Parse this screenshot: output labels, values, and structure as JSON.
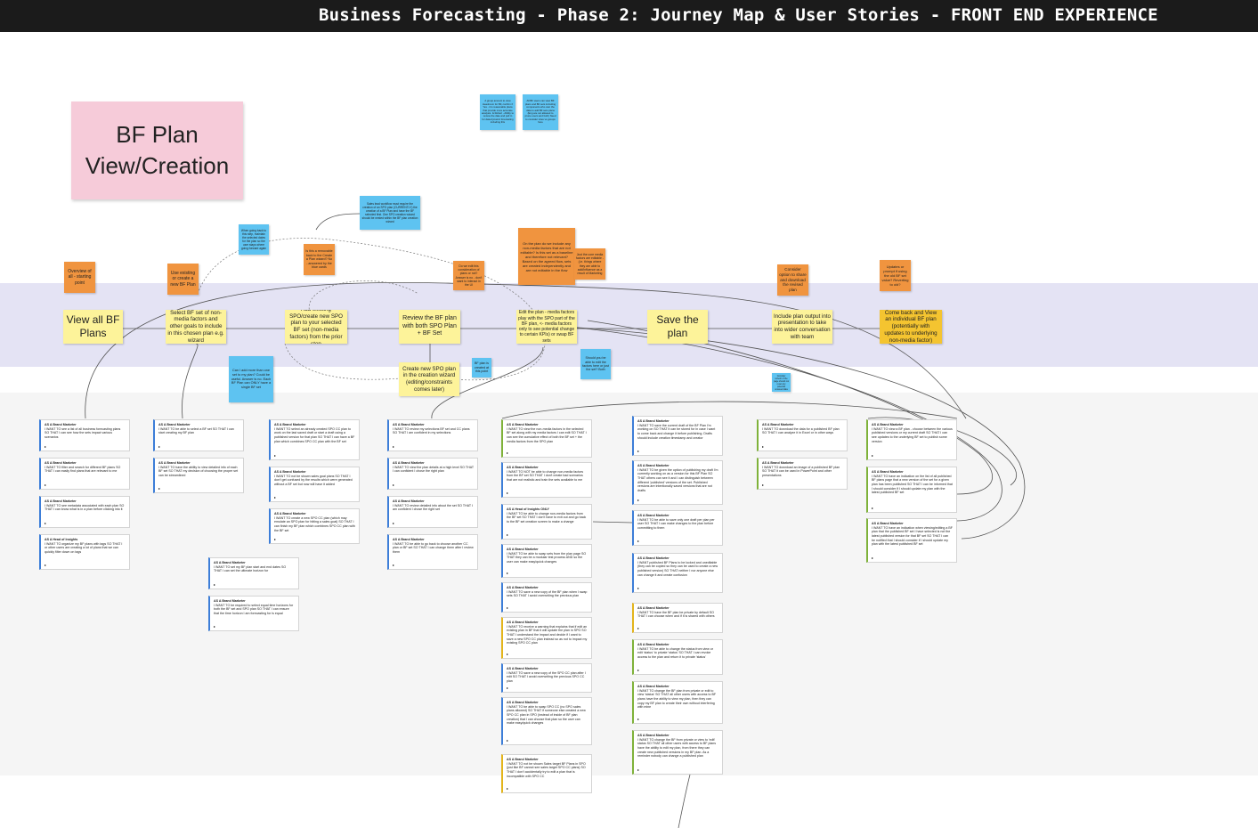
{
  "header": {
    "title": "Business Forecasting - Phase 2: Journey Map & User Stories - FRONT END EXPERIENCE"
  },
  "frame_title": "BF Plan View/Creation",
  "journey_steps": [
    "View all BF Plans",
    "Select BF set of non-media factors and other goals to include in this chosen plan e.g. wizard",
    "Add existing SPO/create new SPO plan to your selected BF set (non-media factors) from the prior step",
    "Review the BF plan with both SPO Plan + BF Set",
    "Edit the plan - media factors play with the SPO part of the BF plan, <- media factors only to see potential change to certain KPIs) or swap BF sets",
    "Save the plan",
    "Include plan output into presentation to take into wider conversation with team",
    "Come back and View an individual BF plan (potentially with updates to underlying non-media factor)"
  ],
  "branch_step": "Create new SPO plan in the creation wizard (editing/constraints comes later)",
  "orange_notes": [
    "Overview of all - starting point",
    "Use existing or create a new BF Plan",
    "Is this a removable back to the Create a Plan wizard? No - answered by the blue cards",
    "Do we edit this consideration of plans or not? Answer is no - don't want to interact in the UI",
    "On the plan do we include any non-media factors that are not editable? Is this set as a baseline and therefore not relevant? Based on the agreed flow, sets are created independently and are not editable in the flow",
    "Just the core media factors are editable - (i.e. things where they are able to add/influence as a result of Marketing",
    "Consider option to share and download the revised plan",
    "Updates or prompt if using the old BF set value? Reverting to old?"
  ],
  "blue_notes": [
    "A group amount to view Headroom for BF, confirm if Yes - it is reasonable plans that provide more accurate analysis. Is Robert - Ability to review the date and pull in for data dynamic forecasting including this",
    "All BF users can view BF plans and BF sets including components who own the data to add BF sets plans (Eng are not allowed to prune users and both) Need to consider roles vs groups here",
    "When going back to this step, maintain the selected dates for the plan so the user stays where going forward again",
    "Sales lead workflow must require the creation of an SPO plan (CURRENTLY) the creation of a BF Plan and have the BF selected first. One SPO creation wizard should be nested within the BF plan creation wizard",
    "Can I add more than one set to my plan? Could be useful. Answer is no. Each BF Plan can ONLY have a single BF set",
    "BF plan is created at this point",
    "Should you be able to edit the factors here or just the set? Both",
    "Consider refresh of the page should not reset any potential unsaved data"
  ],
  "story_columns": [
    {
      "cards": [
        {
          "who": "AS A Brand Marketer",
          "text": "I WANT TO see a list of all business forecasting plans SO THAT I can see how the sets impact various scenarios"
        },
        {
          "who": "AS A Brand Marketer",
          "text": "I WANT TO filter and search for different BF plans SO THAT I can easily find plans that are relevant to me"
        },
        {
          "who": "AS A Brand Marketer",
          "text": "I WANT TO see metadata associated with each plan SO THAT I can know what is in a plan before clicking into it"
        },
        {
          "who": "AS A Head of Insights",
          "text": "I WANT TO organize my BF plans with tags SO THAT I or other users are creating a lot of plans that we can quickly filter down on tags"
        }
      ]
    },
    {
      "cards": [
        {
          "who": "AS A Brand Marketer",
          "text": "I WANT TO be able to select a BF set SO THAT I can start creating my BF plan"
        },
        {
          "who": "AS A Brand Marketer",
          "text": "I WANT TO have the ability to view detailed info of each BF set SO THAT my decision of choosing the proper set can be streamlined"
        }
      ]
    },
    {
      "cards": [
        {
          "who": "AS A Brand Marketer",
          "text": "I WANT TO set my BF plan start and end dates SO THAT I can set the ultimate horizon for"
        },
        {
          "who": "AS A Brand Marketer",
          "text": "I WANT TO be required to select equal time horizons for both the BF set and SPO plan SO THAT I can ensure that the time horizon I am forecasting for is equal"
        }
      ]
    },
    {
      "cards": [
        {
          "who": "AS A Brand Marketer",
          "text": "I WANT TO select an already created SPO CC plan to work on the last saved draft or start a draft using a published version for that plan SO THAT I can have a BF plan which combines SPO CC plan with the BF set"
        },
        {
          "who": "AS A Brand Marketer",
          "text": "I WANT TO not be shown sales goal plans SO THAT I don't get confused by the results which were generated without a BF set but now will have it added"
        },
        {
          "who": "AS A Brand Marketer",
          "text": "I WANT TO create a new SPO CC plan (which may emulate an SPO plan for hitting a sales goal) SO THAT I can finish my BF plan which combines SPO CC plan with the BF set"
        }
      ]
    },
    {
      "cards": [
        {
          "who": "AS A Brand Marketer",
          "text": "I WANT TO review my selections BF set and CC plans SO THAT I am confident in my selections"
        },
        {
          "who": "AS A Brand Marketer",
          "text": "I WANT TO view the plan details at a high level SO THAT I can confident I chose the right plan"
        },
        {
          "who": "AS A Brand Marketer",
          "text": "I WANT TO review detailed info about the set SO THAT I am confident I chose the right set"
        },
        {
          "who": "AS A Brand Marketer",
          "text": "I WANT TO be able to go back to choose another CC plan or BF set SO THAT I can change them after I review them"
        }
      ]
    },
    {
      "cards": [
        {
          "who": "AS A Brand Marketer",
          "text": "I WANT TO view the non-media factors in the selected BF set along with my media factors I can edit SO THAT I can see the cumulative effect of both the BF set + the media factors from the SPO plan"
        },
        {
          "who": "AS A Brand Marketer",
          "text": "I WANT TO NOT be able to change non-media factors from the BF set SO THAT I don't create bad scenarios that are not realistic and train the sets available to me"
        },
        {
          "who": "AS A Head of Insights ONLY",
          "text": "I WANT TO be able to change non-media factors from the BF set SO THAT I don't have to exit out and go back to the BF set creation screen to make a change"
        },
        {
          "who": "AS A Brand Marketer",
          "text": "I WANT TO be able to swap sets from the plan page SO THAT they can be a modular test process AND so the user can make easy/quick changes"
        },
        {
          "who": "AS A Brand Marketer",
          "text": "I WANT TO save a new copy of the BF plan when I swap sets SO THAT I avoid overwriting the previous plan"
        },
        {
          "who": "AS A Brand Marketer",
          "text": "I WANT TO receive a warning that explains that if edit an existing plan in BF that it will update the plan in SPO SO THAT I understand the impact and decide if I want to save a new SPO CC plan instead so as not to impact my existing SPO CC plan"
        },
        {
          "who": "AS A Brand Marketer",
          "text": "I WANT TO save a new copy of the SPO CC plan after I edit SO THAT I avoid overwriting the previous SPO CC plan"
        },
        {
          "who": "AS A Brand Marketer",
          "text": "I WANT TO be able to swap SPO CC (no SPO sales plans allowed) SO THAT if someone else created a new SPO CC plan in SPO (instead of inside of BF plan creation) that I can choose that plan so the user can make easy/quick changes"
        },
        {
          "who": "AS A Brand Marketer",
          "text": "I WANT TO not be shown Sales target BF Plans in SPO (just like BF cannot see sales target SPO CC plans) SO THAT I don't accidentally try to edit a plan that is incompatible with SPO CC"
        }
      ]
    },
    {
      "cards": [
        {
          "who": "AS A Brand Marketer",
          "text": "I WANT TO save the current draft of the BF Plan I'm working on SO THAT it can be stored for in case I want to come back and change it before publishing. Drafts should include creation timestamp and creator"
        },
        {
          "who": "AS A Brand Marketer",
          "text": "I WANT TO be given the option of publishing my draft I'm currently working on as a version for this BF Plan SO THAT others can see it and I can distinguish between different 'published' versions of the set. Published versions are intentionally saved versions that are not drafts"
        },
        {
          "who": "AS A Brand Marketer",
          "text": "I WANT TO be able to save only one draft per plan per user SO THAT I can make changes to the plan before committing to them"
        },
        {
          "who": "AS A Brand Marketer",
          "text": "I WANT published BF Plans to be locked and uneditable (they can be copied so they can be used to create a new published version) SO THAT neither I nor anyone else can change it and create confusion"
        },
        {
          "who": "AS A Brand Marketer",
          "text": "I WANT TO have the BF plan be private by default SO THAT I can choose when and if it is shared with others"
        },
        {
          "who": "AS A Brand Marketer",
          "text": "I WANT TO be able to change the status from view or edit 'status' to private 'status' SO THAT I can revoke access to the plan and return it to private 'status'"
        },
        {
          "who": "AS A Brand Marketer",
          "text": "I WANT TO change the BF plan from private or edit to view 'status' SO THAT all other users with access to BF plans have the ability to view my plan, then they can copy my BF plan to create their own without interfering with mine"
        },
        {
          "who": "AS A Brand Marketer",
          "text": "I WANT TO change the BF from private or view to 'edit' status SO THAT all other users with access to BF plans have the ability to edit my plan, from there they can create new published versions in my BF plan. As a reminder nobody can change a published plan"
        }
      ]
    },
    {
      "cards": [
        {
          "who": "AS A Brand Marketer",
          "text": "I WANT TO download the data for a published BF plan SO THAT I can analyze it in Excel or in other ways"
        },
        {
          "who": "AS A Brand Marketer",
          "text": "I WANT TO download an image of a published BF plan SO THAT it can be used in PowerPoint and other presentations"
        }
      ]
    },
    {
      "cards": [
        {
          "who": "AS A Brand Marketer",
          "text": "I WANT TO view a BF plan - choose between the various published versions or my current draft SO THAT I can see updates to the underlying BF set to publish some version"
        },
        {
          "who": "AS A Brand Marketer",
          "text": "I WANT TO have an indication on the list of all published BF plans page that a new version of the set for a given plan has been published SO THAT I can be informed that I should consider if I should update my plan with the latest published BF set"
        },
        {
          "who": "AS A Brand Marketer",
          "text": "I WANT TO have an indication when viewing/editing a BF plan that the published BF set I have selected is not the latest published version for that BF set SO THAT I can be notified that I should consider if I should update my plan with the latest published BF set"
        }
      ]
    }
  ],
  "colors": {
    "topbar": "#1b1b1b",
    "band": "#e4e3f4",
    "sticky_yellow": "#fdf39a",
    "sticky_orange": "#f0943f",
    "sticky_blue": "#5ec3f1",
    "sticky_gold": "#f4c430",
    "frame_pink": "#f6cbd9"
  }
}
